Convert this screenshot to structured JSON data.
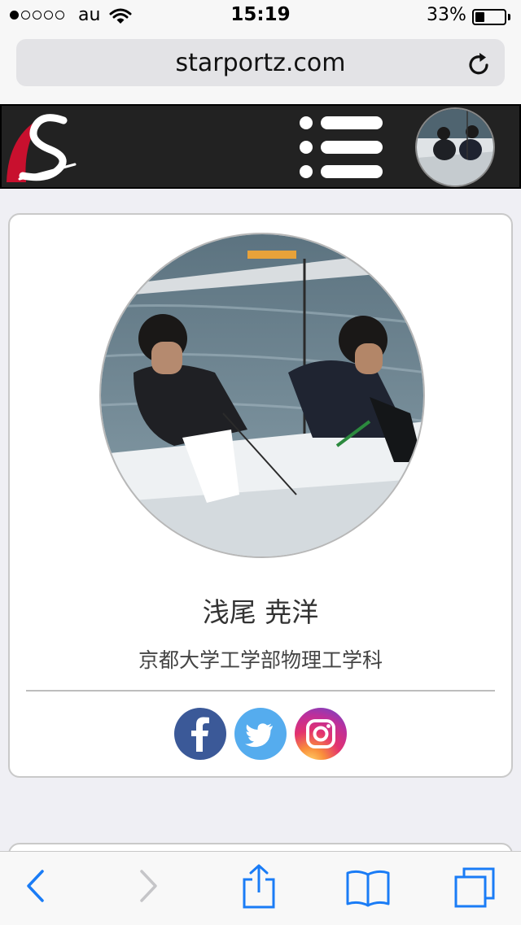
{
  "status_bar": {
    "carrier": "au",
    "time": "15:19",
    "battery_percent": "33%",
    "battery_level": 0.33,
    "signal_bars": 1
  },
  "browser": {
    "url": "starportz.com",
    "icons": {
      "reload": "reload-icon",
      "back": "back-arrow-icon",
      "forward": "forward-arrow-icon",
      "share": "share-icon",
      "bookmarks": "bookmarks-icon",
      "tabs": "tabs-icon"
    }
  },
  "header": {
    "logo": "starportz-logo",
    "menu_icon": "hamburger-menu-icon",
    "avatar": "user-avatar"
  },
  "profile": {
    "name": "浅尾 尭洋",
    "affiliation": "京都大学工学部物理工学科",
    "social": [
      {
        "name": "facebook",
        "icon": "facebook-icon",
        "color": "#3b5998"
      },
      {
        "name": "twitter",
        "icon": "twitter-icon",
        "color": "#55acee"
      },
      {
        "name": "instagram",
        "icon": "instagram-icon",
        "color": "#e3326f"
      }
    ]
  },
  "colors": {
    "header_bg": "#222222",
    "ios_blue": "#1a7cf6",
    "logo_red": "#c8102e"
  }
}
